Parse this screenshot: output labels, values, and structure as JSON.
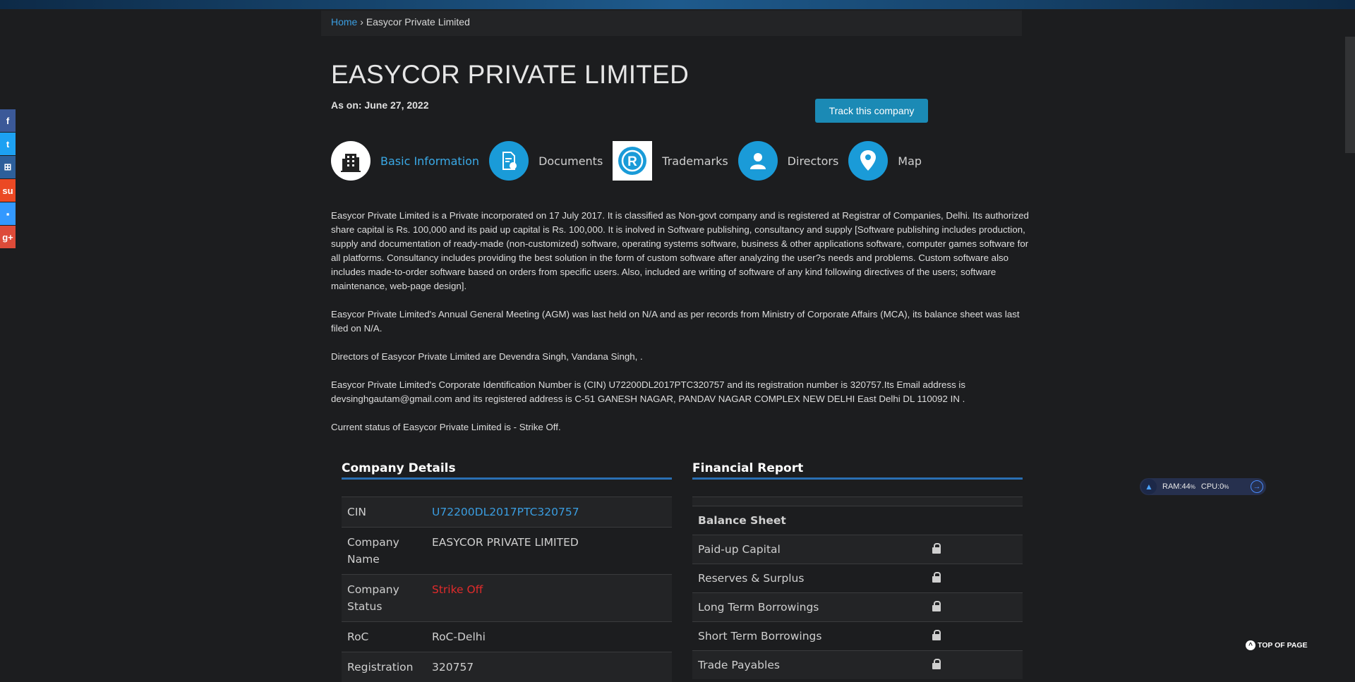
{
  "breadcrumb": {
    "home": "Home",
    "separator": "›",
    "current": "Easycor Private Limited"
  },
  "page_title": "EASYCOR PRIVATE LIMITED",
  "as_on": "As on: June 27, 2022",
  "track_button": "Track this company",
  "tabs": [
    {
      "label": "Basic Information",
      "icon": "building-icon",
      "active": true
    },
    {
      "label": "Documents",
      "icon": "document-icon"
    },
    {
      "label": "Trademarks",
      "icon": "registered-trademark-icon"
    },
    {
      "label": "Directors",
      "icon": "person-icon"
    },
    {
      "label": "Map",
      "icon": "map-pin-icon"
    }
  ],
  "description": [
    "Easycor Private Limited is a Private incorporated on 17 July 2017. It is classified as Non-govt company and is registered at Registrar of Companies, Delhi. Its authorized share capital is Rs. 100,000 and its paid up capital is Rs. 100,000. It is inolved in Software publishing, consultancy and supply [Software publishing includes production, supply and documentation of ready-made (non-customized) software, operating systems software, business & other applications software, computer games software for all platforms. Consultancy includes providing the best solution in the form of custom software after analyzing the user?s needs and problems. Custom software also includes made-to-order software based on orders from specific users. Also, included are writing of software of any kind following directives of the users; software maintenance, web-page design].",
    "Easycor Private Limited's Annual General Meeting (AGM) was last held on N/A and as per records from Ministry of Corporate Affairs (MCA), its balance sheet was last filed on N/A.",
    "Directors of Easycor Private Limited are Devendra Singh, Vandana Singh, .",
    "Easycor Private Limited's Corporate Identification Number is (CIN) U72200DL2017PTC320757 and its registration number is 320757.Its Email address is devsinghgautam@gmail.com and its registered address is C-51 GANESH NAGAR, PANDAV NAGAR COMPLEX NEW DELHI East Delhi DL 110092 IN .",
    "Current status of Easycor Private Limited is - Strike Off."
  ],
  "company_details": {
    "title": "Company Details",
    "rows": [
      {
        "key": "CIN",
        "value": "U72200DL2017PTC320757"
      },
      {
        "key": "Company Name",
        "value": "EASYCOR PRIVATE LIMITED"
      },
      {
        "key": "Company Status",
        "value": "Strike Off"
      },
      {
        "key": "RoC",
        "value": "RoC-Delhi"
      },
      {
        "key": "Registration",
        "value": "320757"
      }
    ]
  },
  "financial_report": {
    "title": "Financial Report",
    "section": "Balance Sheet",
    "rows": [
      "Paid-up Capital",
      "Reserves & Surplus",
      "Long Term Borrowings",
      "Short Term Borrowings",
      "Trade Payables"
    ]
  },
  "social": [
    {
      "name": "facebook",
      "glyph": "f",
      "color": "#3b5998"
    },
    {
      "name": "twitter",
      "glyph": "t",
      "color": "#1da1f2"
    },
    {
      "name": "share",
      "glyph": "⊞",
      "color": "#2d5f9a"
    },
    {
      "name": "stumbleupon",
      "glyph": "su",
      "color": "#eb4924"
    },
    {
      "name": "delicious",
      "glyph": "▪",
      "color": "#3399ff"
    },
    {
      "name": "googleplus",
      "glyph": "g+",
      "color": "#dd4b39"
    }
  ],
  "widget": {
    "ram": "RAM:44",
    "ram_unit": "%",
    "cpu": "CPU:0",
    "cpu_unit": "%"
  },
  "top_of_page": "TOP OF PAGE"
}
